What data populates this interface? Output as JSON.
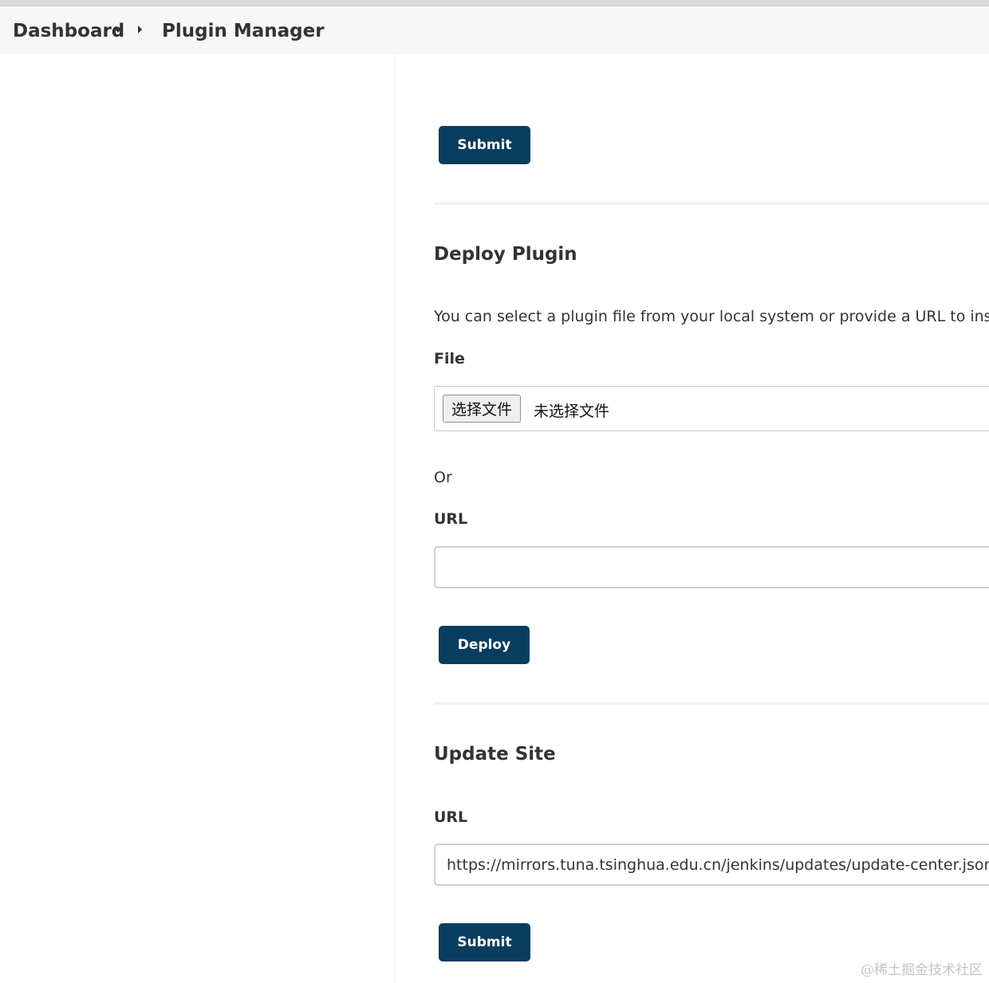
{
  "breadcrumb": {
    "items": [
      {
        "label": "Dashboard"
      },
      {
        "label": "Plugin Manager"
      }
    ]
  },
  "proxy_section": {
    "submit_label": "Submit"
  },
  "deploy_plugin": {
    "heading": "Deploy Plugin",
    "description": "You can select a plugin file from your local system or provide a URL to insta",
    "file_label": "File",
    "choose_file_label": "选择文件",
    "no_file_text": "未选择文件",
    "or_text": "Or",
    "url_label": "URL",
    "url_value": "",
    "deploy_label": "Deploy"
  },
  "update_site": {
    "heading": "Update Site",
    "url_label": "URL",
    "url_value": "https://mirrors.tuna.tsinghua.edu.cn/jenkins/updates/update-center.json",
    "submit_label": "Submit"
  },
  "watermark": "@稀土掘金技术社区",
  "colors": {
    "button_bg": "#093d5e",
    "button_text": "#ffffff",
    "breadcrumb_bg": "#f7f7f7"
  }
}
